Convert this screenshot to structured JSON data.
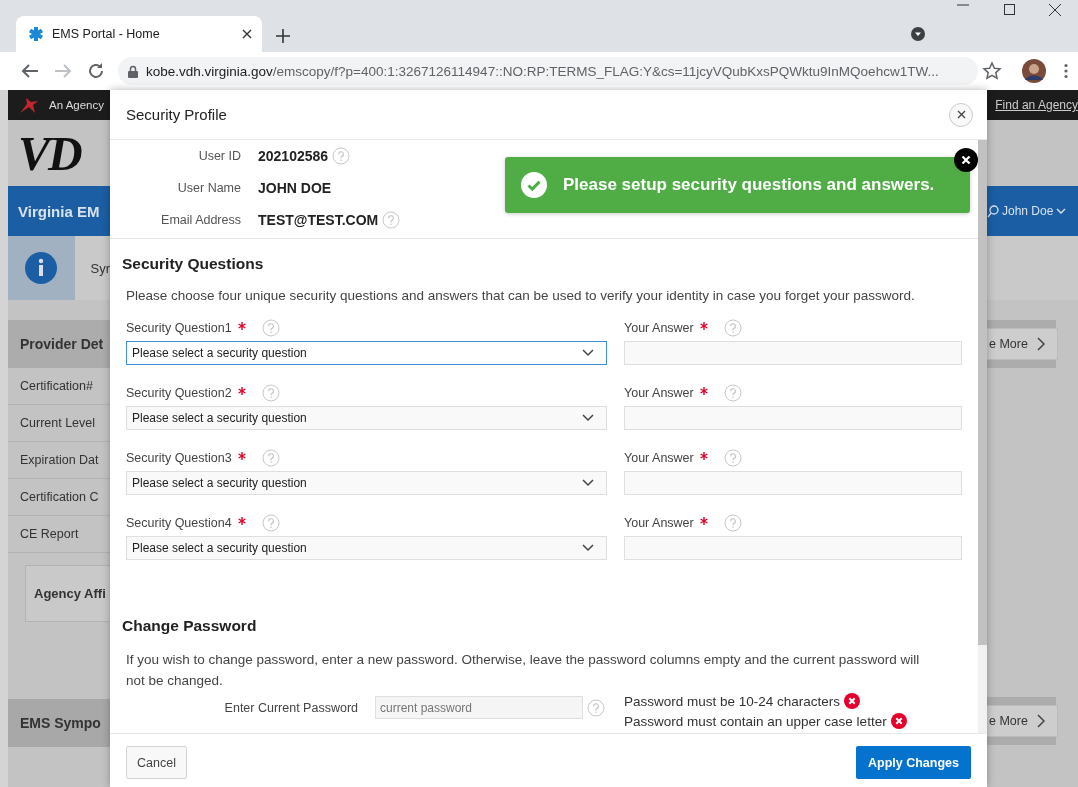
{
  "browser": {
    "tab_title": "EMS Portal - Home",
    "url_host": "kobe.vdh.virginia.gov",
    "url_path": "/emscopy/f?p=400:1:3267126114947::NO:RP:TERMS_FLAG:Y&cs=11jcyVQubKxsPQWktu9InMQoehcw1TW..."
  },
  "background_page": {
    "agency_link": "An Agency",
    "find_agency_link": "Find an Agency",
    "logo": "VD",
    "app_title": "Virginia EM",
    "user_menu": "John Doe",
    "notice": "Syr",
    "provider_panel": {
      "title": "Provider Det",
      "more_button": "e More",
      "items": [
        "Certification#",
        "Current Level",
        "Expiration Dat",
        "Certification C",
        "CE Report"
      ]
    },
    "affiliation_card": "Agency Affi",
    "symposium_panel": {
      "title": "EMS Sympo",
      "more_button": "e More"
    }
  },
  "dialog": {
    "title": "Security Profile",
    "info": [
      {
        "label": "User ID",
        "value": "202102586",
        "help": true
      },
      {
        "label": "User Name",
        "value": "JOHN DOE",
        "help": false
      },
      {
        "label": "Email Address",
        "value": "TEST@TEST.COM",
        "help": true
      }
    ],
    "toast": {
      "message": "Please setup security questions and answers."
    },
    "security_questions": {
      "heading": "Security Questions",
      "description": "Please choose four unique security questions and answers that can be used to verify your identity in case you forget your password.",
      "questions": [
        {
          "label": "Security Question1",
          "required": true,
          "value": "Please select a security question",
          "focused": true,
          "answer_label": "Your Answer",
          "answer_required": true
        },
        {
          "label": "Security Question2",
          "required": true,
          "value": "Please select a security question",
          "focused": false,
          "answer_label": "Your Answer",
          "answer_required": true
        },
        {
          "label": "Security Question3",
          "required": true,
          "value": "Please select a security question",
          "focused": false,
          "answer_label": "Your Answer",
          "answer_required": true
        },
        {
          "label": "Security Question4",
          "required": true,
          "value": "Please select a security question",
          "focused": false,
          "answer_label": "Your Answer",
          "answer_required": true
        }
      ]
    },
    "change_password": {
      "heading": "Change Password",
      "description": "If you wish to change password, enter a new password. Otherwise, leave the password columns empty and the current password will not be changed.",
      "current_password": {
        "label": "Enter Current Password",
        "placeholder": "current password"
      },
      "rules": [
        {
          "text": "Password must be 10-24 characters",
          "met": false
        },
        {
          "text": "Password must contain an upper case letter",
          "met": false
        }
      ]
    },
    "buttons": {
      "cancel": "Cancel",
      "apply": "Apply Changes"
    }
  }
}
